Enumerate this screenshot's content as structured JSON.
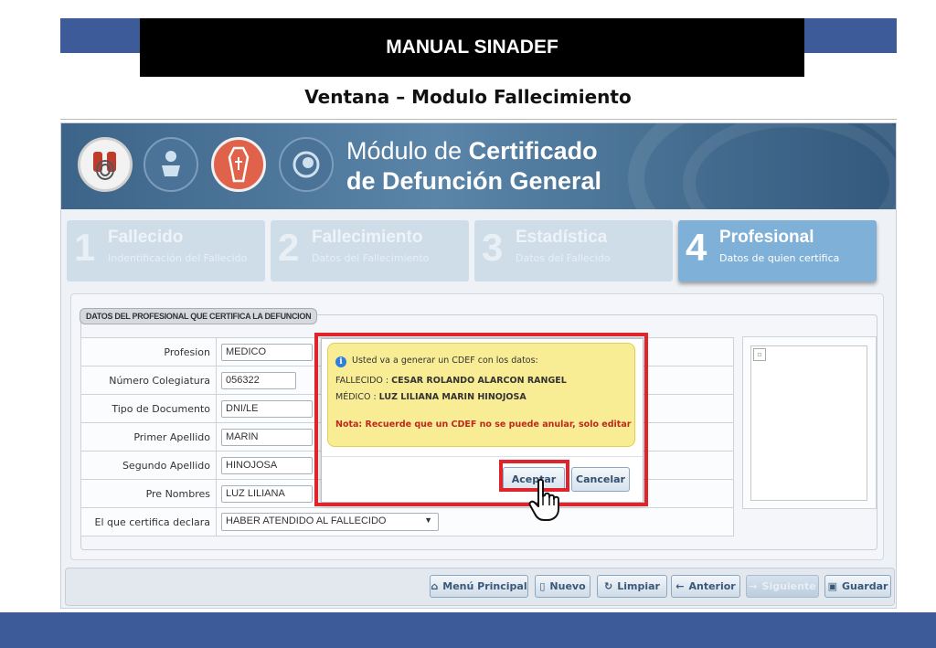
{
  "slide": {
    "header_title": "MANUAL SINADEF",
    "subtitle": "Ventana – Modulo Fallecimiento"
  },
  "app": {
    "title_line1_prefix": "Módulo de ",
    "title_line1_bold": "Certificado",
    "title_line2": "de Defunción General",
    "steps": [
      {
        "num": "1",
        "title": "Fallecido",
        "sub": "Indentificación del Fallecido",
        "active": false
      },
      {
        "num": "2",
        "title": "Fallecimiento",
        "sub": "Datos del Fallecimiento",
        "active": false
      },
      {
        "num": "3",
        "title": "Estadística",
        "sub": "Datos del Fallecido",
        "active": false
      },
      {
        "num": "4",
        "title": "Profesional",
        "sub": "Datos de quien certifica",
        "active": true
      }
    ],
    "legend": "DATOS DEL PROFESIONAL QUE CERTIFICA LA DEFUNCION",
    "form": {
      "profesion_label": "Profesion",
      "profesion_value": "MEDICO",
      "colegiatura_label": "Número Colegiatura",
      "colegiatura_value": "056322",
      "tipo_doc_label": "Tipo de Documento",
      "tipo_doc_value": "DNI/LE",
      "primer_apellido_label": "Primer Apellido",
      "primer_apellido_value": "MARIN",
      "segundo_apellido_label": "Segundo Apellido",
      "segundo_apellido_value": "HINOJOSA",
      "pre_nombres_label": "Pre Nombres",
      "pre_nombres_value": "LUZ LILIANA",
      "declara_label": "El que certifica declara",
      "declara_value": "HABER ATENDIDO AL FALLECIDO"
    },
    "toolbar": {
      "menu": "Menú Principal",
      "nuevo": "Nuevo",
      "limpiar": "Limpiar",
      "anterior": "Anterior",
      "siguiente": "Siguiente",
      "guardar": "Guardar"
    },
    "dialog": {
      "intro": "Usted va a generar un CDEF con los datos:",
      "fallecido_label": "FALLECIDO : ",
      "fallecido_value": "CESAR ROLANDO ALARCON RANGEL",
      "medico_label": "MÉDICO : ",
      "medico_value": "LUZ LILIANA MARIN HINOJOSA",
      "nota": "Nota: Recuerde que un CDEF no se puede anular, solo editar",
      "accept": "Aceptar",
      "cancel": "Cancelar"
    }
  },
  "colors": {
    "slide_blue": "#3d5a99",
    "highlight_red": "#e1232b",
    "dialog_yellow": "#f8ec94",
    "active_step": "#7fb0d8"
  }
}
